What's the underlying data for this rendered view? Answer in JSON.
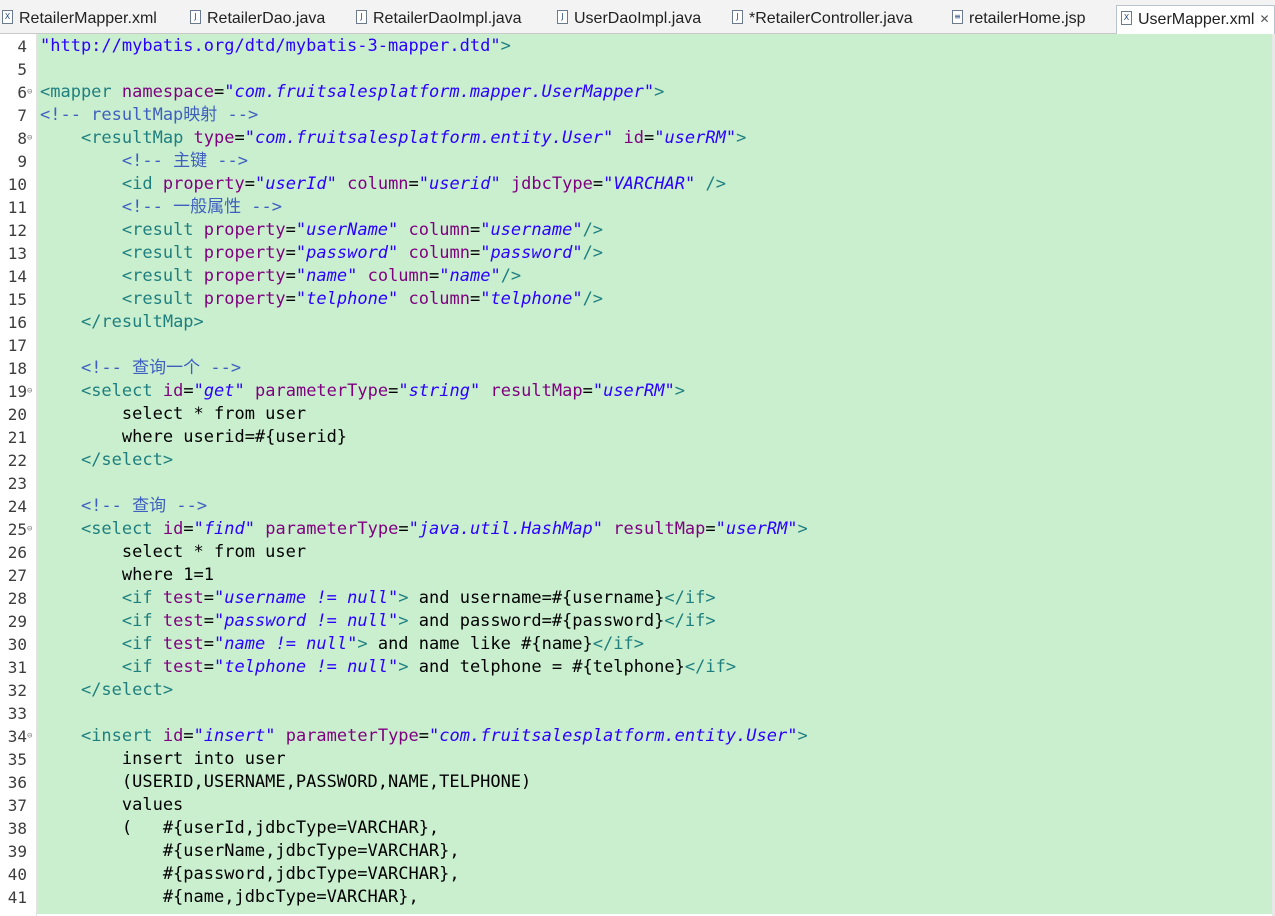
{
  "tabs": [
    {
      "label": "RetailerMapper.xml",
      "icon": "xml-file-icon",
      "icon_glyph": "X",
      "active": false
    },
    {
      "label": "RetailerDao.java",
      "icon": "java-file-icon",
      "icon_glyph": "J",
      "active": false
    },
    {
      "label": "RetailerDaoImpl.java",
      "icon": "java-file-icon",
      "icon_glyph": "J",
      "active": false
    },
    {
      "label": "UserDaoImpl.java",
      "icon": "java-file-icon",
      "icon_glyph": "J",
      "active": false
    },
    {
      "label": "*RetailerController.java",
      "icon": "java-file-icon",
      "icon_glyph": "J",
      "active": false
    },
    {
      "label": "retailerHome.jsp",
      "icon": "jsp-file-icon",
      "icon_glyph": "≡",
      "active": false
    },
    {
      "label": "UserMapper.xml",
      "icon": "xml-file-icon",
      "icon_glyph": "X",
      "active": true,
      "close": "✕"
    }
  ],
  "colors": {
    "tag": "#1f7f7f",
    "attribute": "#7f007f",
    "string": "#2a00ff",
    "comment": "#3f5fbf",
    "text": "#000000",
    "editor_background": "#c9efcf"
  },
  "lines": [
    {
      "n": "4",
      "fold": "",
      "tokens": [
        [
          "str-plain",
          "\"http://mybatis.org/dtd/mybatis-3-mapper.dtd\""
        ],
        [
          "tag",
          ">"
        ]
      ]
    },
    {
      "n": "5",
      "fold": "",
      "tokens": []
    },
    {
      "n": "6",
      "fold": "⊖",
      "tokens": [
        [
          "tag",
          "<mapper "
        ],
        [
          "attr",
          "namespace"
        ],
        [
          "text",
          "="
        ],
        [
          "str",
          "\"com.fruitsalesplatform.mapper.UserMapper\""
        ],
        [
          "tag",
          ">"
        ]
      ]
    },
    {
      "n": "7",
      "fold": "",
      "tokens": [
        [
          "com",
          "<!-- resultMap映射 -->"
        ]
      ]
    },
    {
      "n": "8",
      "fold": "⊖",
      "tokens": [
        [
          "text",
          "    "
        ],
        [
          "tag",
          "<resultMap "
        ],
        [
          "attr",
          "type"
        ],
        [
          "text",
          "="
        ],
        [
          "str",
          "\"com.fruitsalesplatform.entity.User\""
        ],
        [
          "text",
          " "
        ],
        [
          "attr",
          "id"
        ],
        [
          "text",
          "="
        ],
        [
          "str",
          "\"userRM\""
        ],
        [
          "tag",
          ">"
        ]
      ]
    },
    {
      "n": "9",
      "fold": "",
      "tokens": [
        [
          "text",
          "        "
        ],
        [
          "com",
          "<!-- 主键 -->"
        ]
      ]
    },
    {
      "n": "10",
      "fold": "",
      "tokens": [
        [
          "text",
          "        "
        ],
        [
          "tag",
          "<id "
        ],
        [
          "attr",
          "property"
        ],
        [
          "text",
          "="
        ],
        [
          "str",
          "\"userId\""
        ],
        [
          "text",
          " "
        ],
        [
          "attr",
          "column"
        ],
        [
          "text",
          "="
        ],
        [
          "str",
          "\"userid\""
        ],
        [
          "text",
          " "
        ],
        [
          "attr",
          "jdbcType"
        ],
        [
          "text",
          "="
        ],
        [
          "str",
          "\"VARCHAR\""
        ],
        [
          "text",
          " "
        ],
        [
          "tag",
          "/>"
        ]
      ]
    },
    {
      "n": "11",
      "fold": "",
      "tokens": [
        [
          "text",
          "        "
        ],
        [
          "com",
          "<!-- 一般属性 -->"
        ]
      ]
    },
    {
      "n": "12",
      "fold": "",
      "tokens": [
        [
          "text",
          "        "
        ],
        [
          "tag",
          "<result "
        ],
        [
          "attr",
          "property"
        ],
        [
          "text",
          "="
        ],
        [
          "str",
          "\"userName\""
        ],
        [
          "text",
          " "
        ],
        [
          "attr",
          "column"
        ],
        [
          "text",
          "="
        ],
        [
          "str",
          "\"username\""
        ],
        [
          "tag",
          "/>"
        ]
      ]
    },
    {
      "n": "13",
      "fold": "",
      "tokens": [
        [
          "text",
          "        "
        ],
        [
          "tag",
          "<result "
        ],
        [
          "attr",
          "property"
        ],
        [
          "text",
          "="
        ],
        [
          "str",
          "\"password\""
        ],
        [
          "text",
          " "
        ],
        [
          "attr",
          "column"
        ],
        [
          "text",
          "="
        ],
        [
          "str",
          "\"password\""
        ],
        [
          "tag",
          "/>"
        ]
      ]
    },
    {
      "n": "14",
      "fold": "",
      "tokens": [
        [
          "text",
          "        "
        ],
        [
          "tag",
          "<result "
        ],
        [
          "attr",
          "property"
        ],
        [
          "text",
          "="
        ],
        [
          "str",
          "\"name\""
        ],
        [
          "text",
          " "
        ],
        [
          "attr",
          "column"
        ],
        [
          "text",
          "="
        ],
        [
          "str",
          "\"name\""
        ],
        [
          "tag",
          "/>"
        ]
      ]
    },
    {
      "n": "15",
      "fold": "",
      "tokens": [
        [
          "text",
          "        "
        ],
        [
          "tag",
          "<result "
        ],
        [
          "attr",
          "property"
        ],
        [
          "text",
          "="
        ],
        [
          "str",
          "\"telphone\""
        ],
        [
          "text",
          " "
        ],
        [
          "attr",
          "column"
        ],
        [
          "text",
          "="
        ],
        [
          "str",
          "\"telphone\""
        ],
        [
          "tag",
          "/>"
        ]
      ]
    },
    {
      "n": "16",
      "fold": "",
      "tokens": [
        [
          "text",
          "    "
        ],
        [
          "tag",
          "</resultMap>"
        ]
      ]
    },
    {
      "n": "17",
      "fold": "",
      "tokens": []
    },
    {
      "n": "18",
      "fold": "",
      "tokens": [
        [
          "text",
          "    "
        ],
        [
          "com",
          "<!-- 查询一个 -->"
        ]
      ]
    },
    {
      "n": "19",
      "fold": "⊖",
      "tokens": [
        [
          "text",
          "    "
        ],
        [
          "tag",
          "<select "
        ],
        [
          "attr",
          "id"
        ],
        [
          "text",
          "="
        ],
        [
          "str",
          "\"get\""
        ],
        [
          "text",
          " "
        ],
        [
          "attr",
          "parameterType"
        ],
        [
          "text",
          "="
        ],
        [
          "str",
          "\"string\""
        ],
        [
          "text",
          " "
        ],
        [
          "attr",
          "resultMap"
        ],
        [
          "text",
          "="
        ],
        [
          "str",
          "\"userRM\""
        ],
        [
          "tag",
          ">"
        ]
      ]
    },
    {
      "n": "20",
      "fold": "",
      "tokens": [
        [
          "text",
          "        select * from user"
        ]
      ]
    },
    {
      "n": "21",
      "fold": "",
      "tokens": [
        [
          "text",
          "        where userid=#{userid}"
        ]
      ]
    },
    {
      "n": "22",
      "fold": "",
      "tokens": [
        [
          "text",
          "    "
        ],
        [
          "tag",
          "</select>"
        ]
      ]
    },
    {
      "n": "23",
      "fold": "",
      "tokens": []
    },
    {
      "n": "24",
      "fold": "",
      "tokens": [
        [
          "text",
          "    "
        ],
        [
          "com",
          "<!-- 查询 -->"
        ]
      ]
    },
    {
      "n": "25",
      "fold": "⊖",
      "tokens": [
        [
          "text",
          "    "
        ],
        [
          "tag",
          "<select "
        ],
        [
          "attr",
          "id"
        ],
        [
          "text",
          "="
        ],
        [
          "str",
          "\"find\""
        ],
        [
          "text",
          " "
        ],
        [
          "attr",
          "parameterType"
        ],
        [
          "text",
          "="
        ],
        [
          "str",
          "\"java.util.HashMap\""
        ],
        [
          "text",
          " "
        ],
        [
          "attr",
          "resultMap"
        ],
        [
          "text",
          "="
        ],
        [
          "str",
          "\"userRM\""
        ],
        [
          "tag",
          ">"
        ]
      ]
    },
    {
      "n": "26",
      "fold": "",
      "tokens": [
        [
          "text",
          "        select * from user"
        ]
      ]
    },
    {
      "n": "27",
      "fold": "",
      "tokens": [
        [
          "text",
          "        where 1=1"
        ]
      ]
    },
    {
      "n": "28",
      "fold": "",
      "tokens": [
        [
          "text",
          "        "
        ],
        [
          "tag",
          "<if "
        ],
        [
          "attr",
          "test"
        ],
        [
          "text",
          "="
        ],
        [
          "str",
          "\"username != null\""
        ],
        [
          "tag",
          ">"
        ],
        [
          "text",
          " and username=#{username}"
        ],
        [
          "tag",
          "</if>"
        ]
      ]
    },
    {
      "n": "29",
      "fold": "",
      "tokens": [
        [
          "text",
          "        "
        ],
        [
          "tag",
          "<if "
        ],
        [
          "attr",
          "test"
        ],
        [
          "text",
          "="
        ],
        [
          "str",
          "\"password != null\""
        ],
        [
          "tag",
          ">"
        ],
        [
          "text",
          " and password=#{password}"
        ],
        [
          "tag",
          "</if>"
        ]
      ]
    },
    {
      "n": "30",
      "fold": "",
      "tokens": [
        [
          "text",
          "        "
        ],
        [
          "tag",
          "<if "
        ],
        [
          "attr",
          "test"
        ],
        [
          "text",
          "="
        ],
        [
          "str",
          "\"name != null\""
        ],
        [
          "tag",
          ">"
        ],
        [
          "text",
          " and name like #{name}"
        ],
        [
          "tag",
          "</if>"
        ]
      ]
    },
    {
      "n": "31",
      "fold": "",
      "tokens": [
        [
          "text",
          "        "
        ],
        [
          "tag",
          "<if "
        ],
        [
          "attr",
          "test"
        ],
        [
          "text",
          "="
        ],
        [
          "str",
          "\"telphone != null\""
        ],
        [
          "tag",
          ">"
        ],
        [
          "text",
          " and telphone = #{telphone}"
        ],
        [
          "tag",
          "</if>"
        ]
      ]
    },
    {
      "n": "32",
      "fold": "",
      "tokens": [
        [
          "text",
          "    "
        ],
        [
          "tag",
          "</select>"
        ]
      ]
    },
    {
      "n": "33",
      "fold": "",
      "tokens": []
    },
    {
      "n": "34",
      "fold": "⊖",
      "tokens": [
        [
          "text",
          "    "
        ],
        [
          "tag",
          "<insert "
        ],
        [
          "attr",
          "id"
        ],
        [
          "text",
          "="
        ],
        [
          "str",
          "\"insert\""
        ],
        [
          "text",
          " "
        ],
        [
          "attr",
          "parameterType"
        ],
        [
          "text",
          "="
        ],
        [
          "str",
          "\"com.fruitsalesplatform.entity.User\""
        ],
        [
          "tag",
          ">"
        ]
      ]
    },
    {
      "n": "35",
      "fold": "",
      "tokens": [
        [
          "text",
          "        insert into user"
        ]
      ]
    },
    {
      "n": "36",
      "fold": "",
      "tokens": [
        [
          "text",
          "        (USERID,USERNAME,PASSWORD,NAME,TELPHONE)"
        ]
      ]
    },
    {
      "n": "37",
      "fold": "",
      "tokens": [
        [
          "text",
          "        values"
        ]
      ]
    },
    {
      "n": "38",
      "fold": "",
      "tokens": [
        [
          "text",
          "        (   #{userId,jdbcType=VARCHAR},"
        ]
      ]
    },
    {
      "n": "39",
      "fold": "",
      "tokens": [
        [
          "text",
          "            #{userName,jdbcType=VARCHAR},"
        ]
      ]
    },
    {
      "n": "40",
      "fold": "",
      "tokens": [
        [
          "text",
          "            #{password,jdbcType=VARCHAR},"
        ]
      ]
    },
    {
      "n": "41",
      "fold": "",
      "tokens": [
        [
          "text",
          "            #{name,jdbcType=VARCHAR},"
        ]
      ]
    }
  ]
}
